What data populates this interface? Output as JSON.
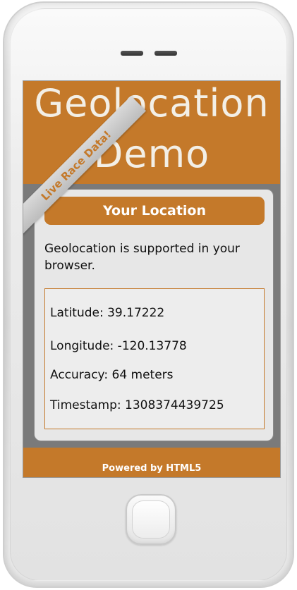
{
  "app": {
    "title_line1": "Geolocation",
    "title_line2": "Demo",
    "ribbon": "Live Race Data!"
  },
  "panel": {
    "heading": "Your Location",
    "support_message": "Geolocation is supported in your browser."
  },
  "location": {
    "latitude": "Latitude: 39.17222",
    "longitude": "Longitude: -120.13778",
    "accuracy": "Accuracy: 64 meters",
    "timestamp": "Timestamp: 1308374439725"
  },
  "footer": {
    "text": "Powered by HTML5"
  },
  "colors": {
    "accent": "#c4792a",
    "screen_background": "#7a7a7a",
    "panel_background": "#e7e7e7"
  }
}
